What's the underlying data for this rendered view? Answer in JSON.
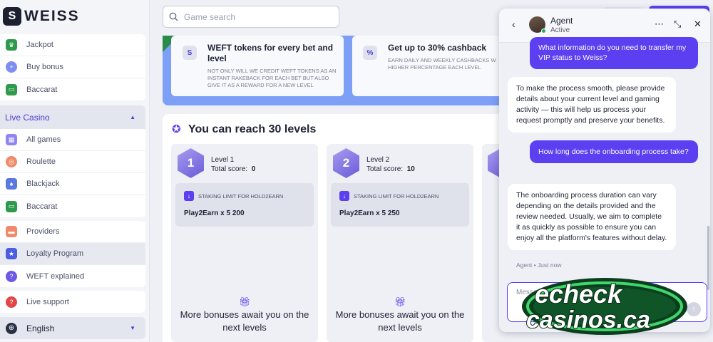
{
  "brand": {
    "logo_badge": "S",
    "logo_text": "WEISS"
  },
  "search": {
    "placeholder": "Game search"
  },
  "sidebar": {
    "top_items": [
      {
        "label": "Jackpot",
        "icon": "jackpot-icon"
      },
      {
        "label": "Buy bonus",
        "icon": "buy-bonus-icon"
      },
      {
        "label": "Baccarat",
        "icon": "baccarat-icon"
      }
    ],
    "live_casino": {
      "label": "Live Casino"
    },
    "live_items": [
      {
        "label": "All games",
        "icon": "all-games-icon"
      },
      {
        "label": "Roulette",
        "icon": "roulette-icon"
      },
      {
        "label": "Blackjack",
        "icon": "blackjack-icon"
      },
      {
        "label": "Baccarat",
        "icon": "baccarat-icon"
      }
    ],
    "info_items": [
      {
        "label": "Providers",
        "icon": "providers-icon"
      },
      {
        "label": "Loyalty Program",
        "icon": "loyalty-icon"
      },
      {
        "label": "WEFT explained",
        "icon": "help-icon"
      }
    ],
    "support": {
      "label": "Live support"
    },
    "language": {
      "label": "English"
    }
  },
  "promo_cards": [
    {
      "icon": "S",
      "title": "WEFT tokens for every bet and level",
      "desc": "Not only will we credit WEFT tokens as an instant rakeback for each bet but also give it as a reward for a new level"
    },
    {
      "icon": "%",
      "title": "Get up to 30% cashback",
      "desc": "Earn daily and weekly cashbacks w higher percentage each level"
    }
  ],
  "levels": {
    "title": "You can reach 30 levels",
    "score_label": "Total score:",
    "stake_label": "Staking limit for Hold2Earn",
    "more_text": "More bonuses await you on the next levels",
    "items": [
      {
        "num": "1",
        "name": "Level 1",
        "score": "0",
        "stake": "Play2Earn x 5 200"
      },
      {
        "num": "2",
        "name": "Level 2",
        "score": "10",
        "stake": "Play2Earn x 5 250"
      }
    ]
  },
  "chat": {
    "agent_name": "Agent",
    "agent_status": "Active",
    "messages": [
      {
        "from": "user",
        "text": "What information do you need to transfer my VIP status to Weiss?"
      },
      {
        "from": "agent",
        "text": "To make the process smooth, please provide details about your current level and gaming activity — this will help us process your request promptly and preserve your benefits."
      },
      {
        "from": "user",
        "text": "How long does the onboarding process take?"
      },
      {
        "from": "agent",
        "text": "The onboarding process duration can vary depending on the details provided and the review needed. Usually, we aim to complete it as quickly as possible to ensure you can enjoy all the platform's features without delay."
      }
    ],
    "meta": "Agent • Just now",
    "composer_placeholder": "Message..."
  },
  "watermark": {
    "line1": "echeck",
    "line2": "casinos.ca"
  },
  "colors": {
    "accent": "#5b3ff0",
    "band": "#7e9ff6"
  }
}
